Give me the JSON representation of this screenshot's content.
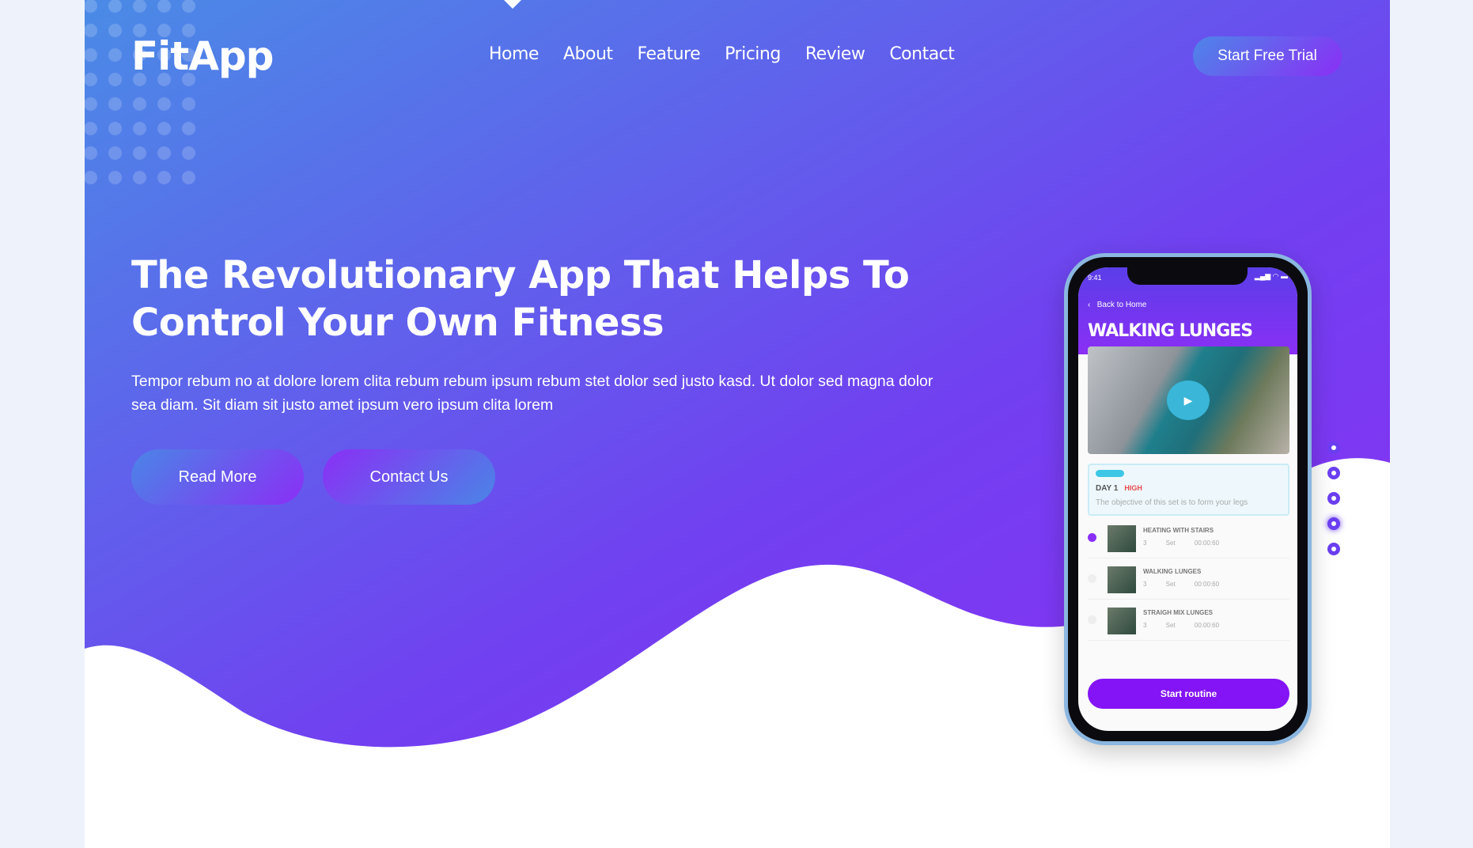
{
  "brand": {
    "logo": "FitApp"
  },
  "nav": {
    "items": [
      "Home",
      "About",
      "Feature",
      "Pricing",
      "Review",
      "Contact"
    ],
    "cta": "Start Free Trial"
  },
  "hero": {
    "title": "The Revolutionary App That Helps To Control Your Own Fitness",
    "text": "Tempor rebum no at dolore lorem clita rebum rebum ipsum rebum stet dolor sed justo kasd. Ut dolor sed magna dolor sea diam. Sit diam sit justo amet ipsum vero ipsum clita lorem",
    "read_more": "Read More",
    "contact_us": "Contact Us"
  },
  "phone": {
    "time": "9:41",
    "back": "Back to Home",
    "title": "WALKING LUNGES",
    "day": "DAY 1",
    "level": "HIGH",
    "objective": "The objective of this set is to form your legs",
    "exercises": [
      {
        "name": "HEATING WITH STAIRS",
        "sets": "3 Set",
        "time": "00:00:60"
      },
      {
        "name": "WALKING  LUNGES",
        "sets": "3 Set",
        "time": "00:00:60"
      },
      {
        "name": "STRAIGH MIX LUNGES",
        "sets": "3 Set",
        "time": "00:00:60"
      }
    ],
    "start": "Start routine"
  },
  "carousel": {
    "count": 5,
    "active": 4
  },
  "colors": {
    "gradient_start": "#4a8be6",
    "gradient_end": "#7b2ff5",
    "accent": "#8414f5"
  }
}
